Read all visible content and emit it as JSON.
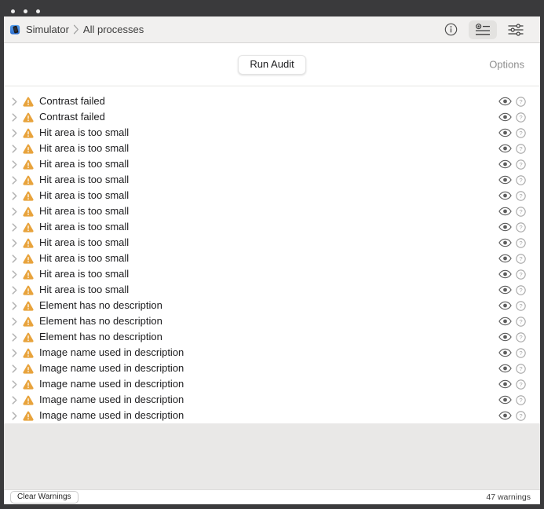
{
  "window": {
    "titlebar": {
      "traffic_dots": 3
    }
  },
  "toolbar": {
    "app_icon": "simulator-app-icon",
    "breadcrumb": {
      "app": "Simulator",
      "separator_icon": "breadcrumb-chevron-icon",
      "target": "All processes"
    },
    "icons": {
      "info": "info-circle-icon",
      "audit": "audit-checklist-icon",
      "filters": "filter-sliders-icon"
    },
    "active_icon": "audit"
  },
  "audit_header": {
    "run_button": "Run Audit",
    "options": "Options"
  },
  "warning_list": {
    "row_icons": {
      "expand": "chevron-right-icon",
      "severity": "warning-triangle-icon",
      "preview": "eye-icon",
      "help": "question-mark-icon"
    },
    "rows": [
      {
        "label": "Contrast failed"
      },
      {
        "label": "Contrast failed"
      },
      {
        "label": "Hit area is too small"
      },
      {
        "label": "Hit area is too small"
      },
      {
        "label": "Hit area is too small"
      },
      {
        "label": "Hit area is too small"
      },
      {
        "label": "Hit area is too small"
      },
      {
        "label": "Hit area is too small"
      },
      {
        "label": "Hit area is too small"
      },
      {
        "label": "Hit area is too small"
      },
      {
        "label": "Hit area is too small"
      },
      {
        "label": "Hit area is too small"
      },
      {
        "label": "Hit area is too small"
      },
      {
        "label": "Element has no description"
      },
      {
        "label": "Element has no description"
      },
      {
        "label": "Element has no description"
      },
      {
        "label": "Image name used in description"
      },
      {
        "label": "Image name used in description"
      },
      {
        "label": "Image name used in description"
      },
      {
        "label": "Image name used in description"
      },
      {
        "label": "Image name used in description"
      }
    ]
  },
  "footer": {
    "clear_button": "Clear Warnings",
    "warning_count": "47 warnings"
  },
  "colors": {
    "warning": "#E8A33C",
    "frame": "#3A3A3C",
    "toolbar_bg": "#F1F0EF",
    "selected_icon_bg": "#E3E2E0",
    "empty_bg": "#E9E8E7",
    "row_text": "#1C1C1E",
    "muted_text": "#8E8E8E"
  }
}
